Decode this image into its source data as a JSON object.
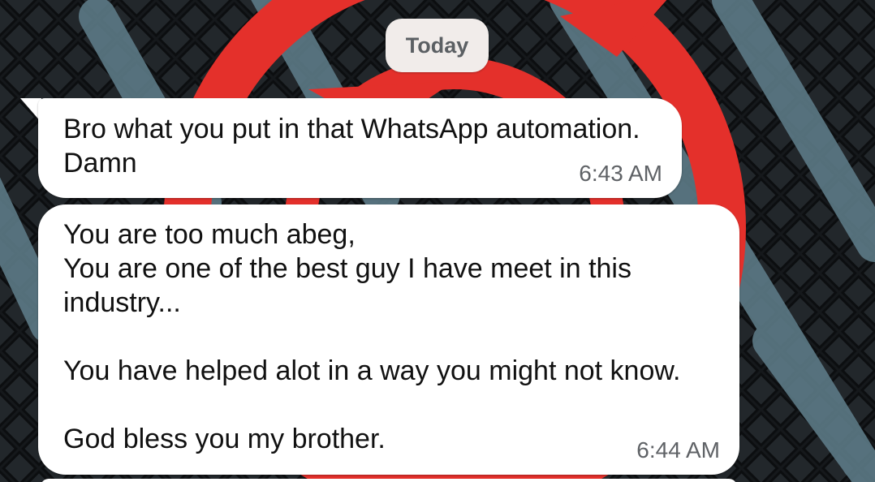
{
  "chat": {
    "date_separator": "Today",
    "messages": [
      {
        "text": "Bro what you put in that WhatsApp automation.\nDamn",
        "time": "6:43 AM"
      },
      {
        "text": "You are too much abeg,\nYou are one of the best guy I have meet in this\nindustry...\n\nYou have helped alot in a way you might not know.\n\nGod bless you my brother.",
        "time": "6:44 AM"
      }
    ]
  },
  "theme": {
    "bubble_incoming": "#ffffff",
    "date_chip": "#f1ecea",
    "wallpaper_dark": "#141619",
    "wallpaper_red": "#e4302b",
    "wallpaper_stripe": "#5f7d88"
  }
}
